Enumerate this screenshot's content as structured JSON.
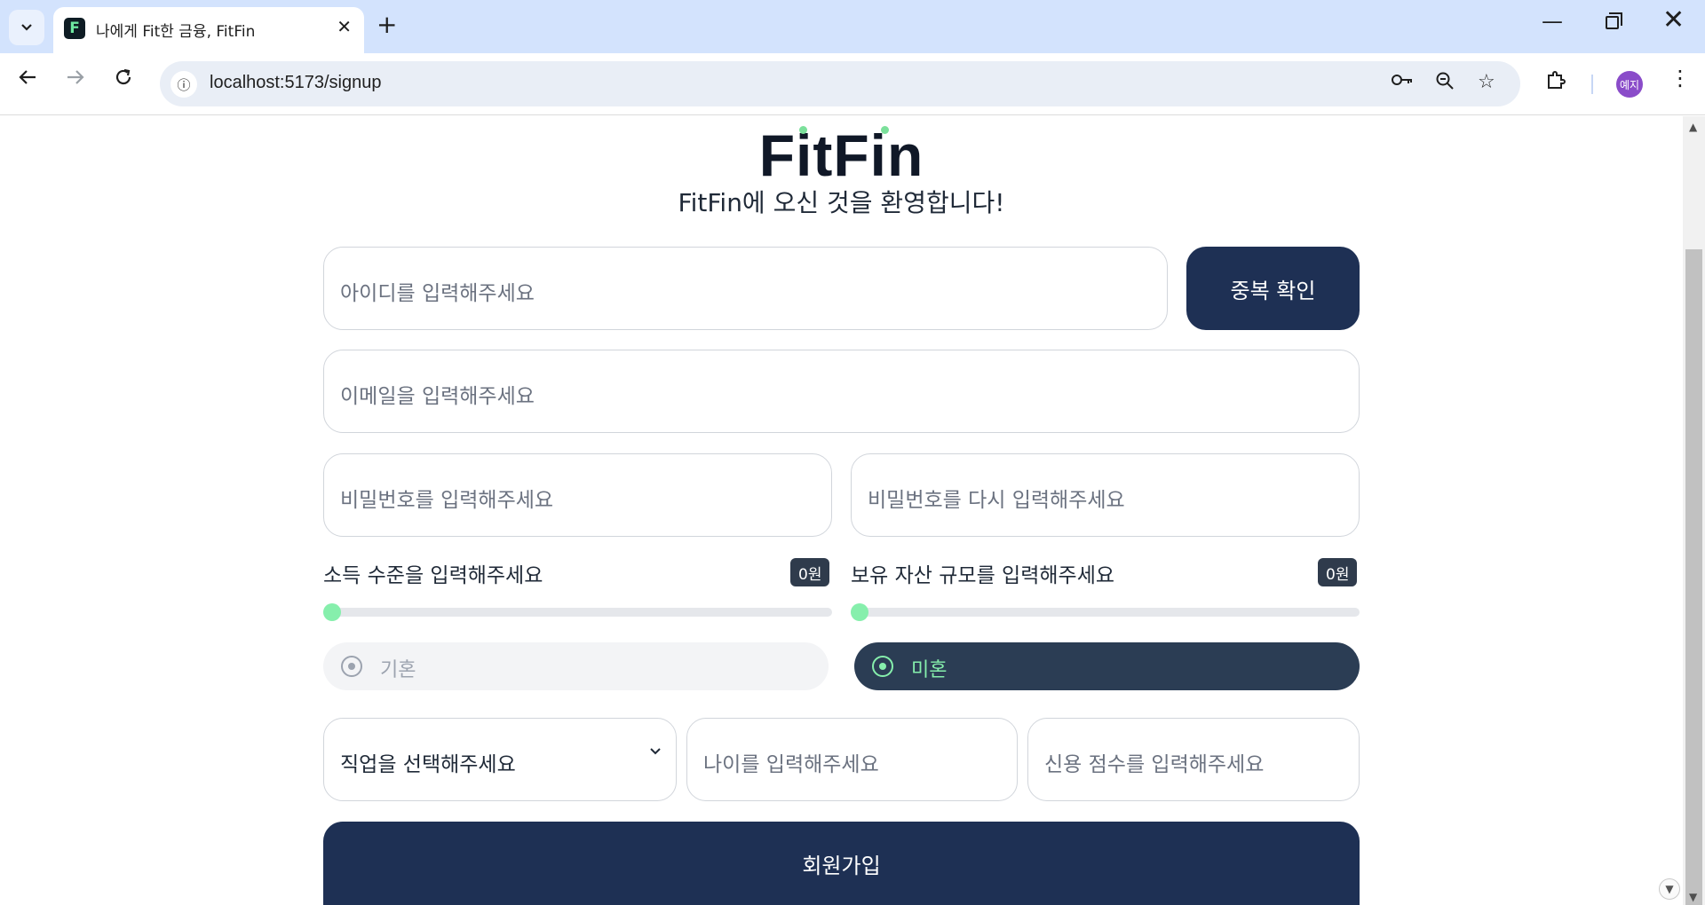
{
  "browser": {
    "tab_title": "나에게 Fit한 금융, FitFin",
    "favicon_letter": "F",
    "url": "localhost:5173/signup",
    "profile_initials": "예지",
    "icons": {
      "tab_search": "chevron-down-icon",
      "close": "close-icon",
      "new_tab": "plus-icon",
      "back": "arrow-left-icon",
      "forward": "arrow-right-icon",
      "reload": "reload-icon",
      "site_info": "info-icon",
      "password": "key-icon",
      "zoom": "zoom-out-icon",
      "bookmark": "star-icon",
      "extensions": "puzzle-icon",
      "menu": "more-vert-icon"
    }
  },
  "page": {
    "logo": "FitFin",
    "welcome": "FitFin에 오신 것을 환영합니다!",
    "id_placeholder": "아이디를 입력해주세요",
    "dup_check_label": "중복 확인",
    "email_placeholder": "이메일을 입력해주세요",
    "password_placeholder": "비밀번호를 입력해주세요",
    "password_confirm_placeholder": "비밀번호를 다시 입력해주세요",
    "income": {
      "label": "소득 수준을 입력해주세요",
      "value_text": "0원",
      "value": 0
    },
    "assets": {
      "label": "보유 자산 규모를 입력해주세요",
      "value_text": "0원",
      "value": 0
    },
    "marital": {
      "options": [
        "기혼",
        "미혼"
      ],
      "selected": "미혼"
    },
    "job_placeholder": "직업을 선택해주세요",
    "age_placeholder": "나이를 입력해주세요",
    "credit_placeholder": "신용 점수를 입력해주세요",
    "signup_label": "회원가입"
  },
  "colors": {
    "primary": "#1e3054",
    "accent": "#86efac",
    "badge": "#2f3b4c"
  }
}
